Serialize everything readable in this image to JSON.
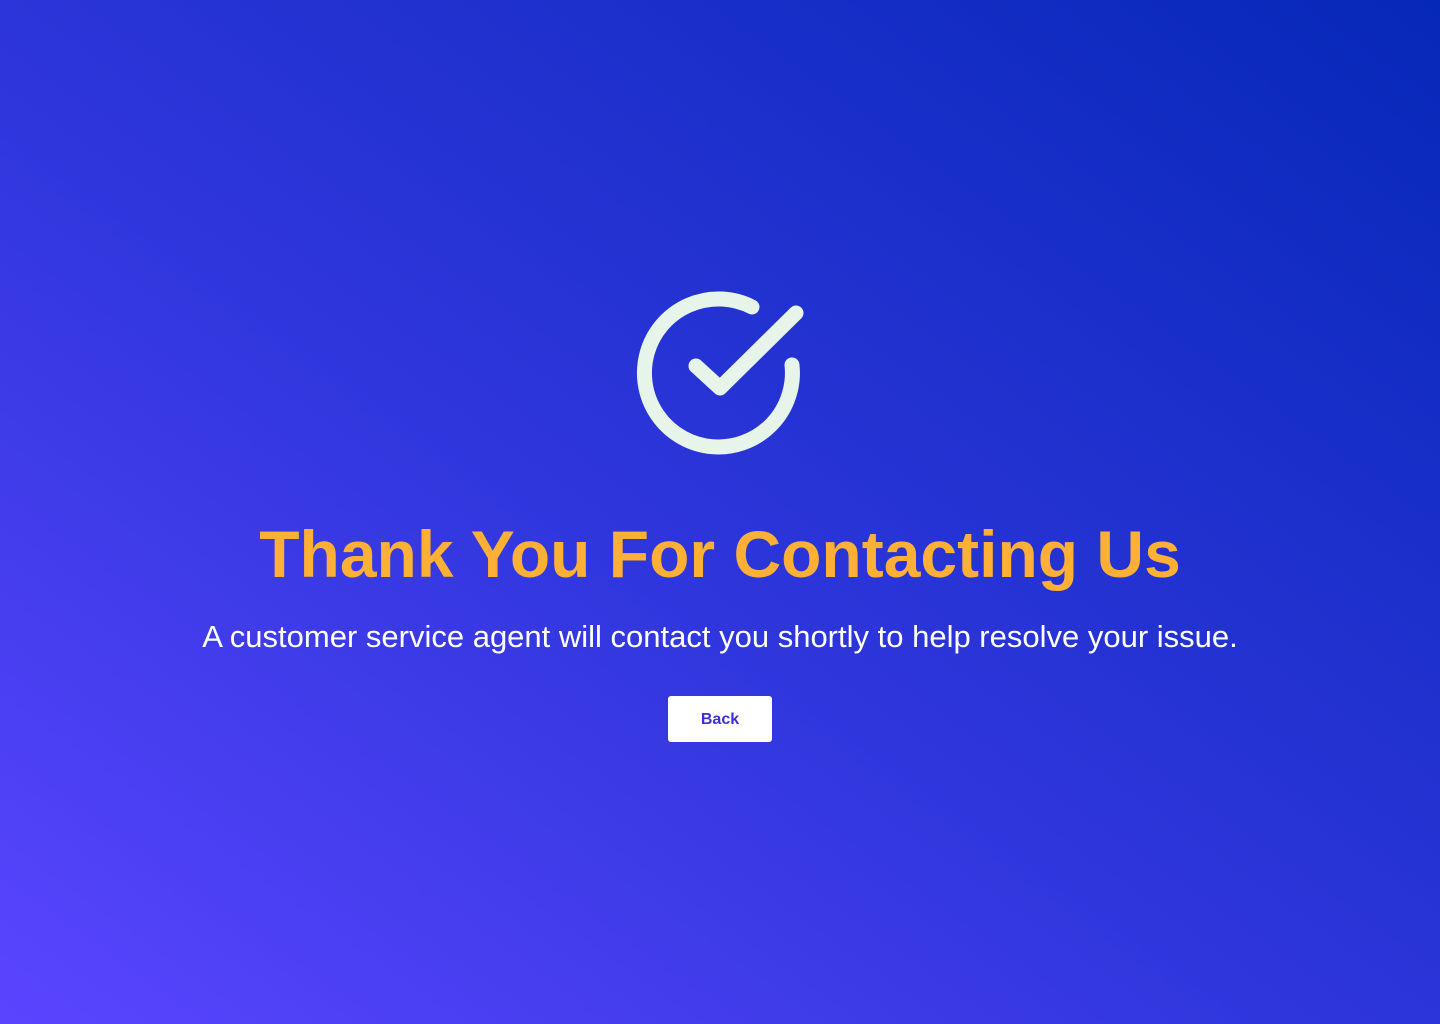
{
  "icon": "check-circle-icon",
  "title": "Thank You For Contacting Us",
  "message": "A customer service agent will contact you shortly to help resolve your issue.",
  "back_button": {
    "label": "Back"
  },
  "colors": {
    "title": "#FDB035",
    "icon": "#E6F4EA",
    "background_start": "#5A45FF",
    "background_end": "#0628B8",
    "button_background": "#FFFFFF",
    "button_text": "#3A2FD8"
  }
}
